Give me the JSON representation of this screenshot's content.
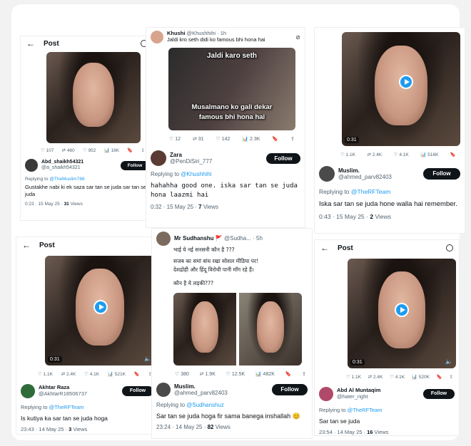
{
  "p1": {
    "header": {
      "back": "←",
      "title": "Post"
    },
    "stats": [
      "♡ 107",
      "⇄ 460",
      "♡ 952",
      "📊 16K",
      "🔖",
      "⇪"
    ],
    "user": {
      "name": "Abd_shaikh54321",
      "handle": "@a_shaikh54321"
    },
    "follow": "Follow",
    "reply_prefix": "Replying to ",
    "reply_to": "@TheMuslim786",
    "text": "Gustakhe nabi ki ek saza sar tan se juda sar tan se juda",
    "time": "0:23 · 15 May 25 · ",
    "views": "31",
    "views_label": " Views"
  },
  "p2": {
    "top": {
      "name": "Khushi",
      "handle": "@Khushhihi · 1h",
      "text": "Jaldi kro seth didi ko famous bhi hona hai"
    },
    "meme_top": "Jaldi karo seth",
    "meme_bottom1": "Musalmano ko gali dekar",
    "meme_bottom2": "famous bhi hona hai",
    "stats": [
      "♡ 12",
      "⇄ 31",
      "♡ 142",
      "📊 2.3K",
      "🔖",
      "⇪"
    ],
    "user": {
      "name": "Zara",
      "handle": "@PenDiSiri_777"
    },
    "follow": "Follow",
    "reply_prefix": "Replying to ",
    "reply_to": "@Khushhihi",
    "text": "hahahha good one. iska sar tan se juda hona laazmi hai",
    "time": "0:32 · 15 May 25 · ",
    "views": "7",
    "views_label": " Views"
  },
  "p3": {
    "dur": "0:31",
    "stats": [
      "♡ 1.1K",
      "⇄ 2.4K",
      "♡ 4.1K",
      "📊 516K",
      "🔖"
    ],
    "user": {
      "name": "Muslim.",
      "handle": "@ahmed_parv82403"
    },
    "follow": "Follow",
    "reply_prefix": "Replying to ",
    "reply_to": "@TheRFTeam",
    "text": "Iska sar tan se juda hone walla hai remember.",
    "time": "0:43 · 15 May 25 · ",
    "views": "2",
    "views_label": " Views"
  },
  "p4": {
    "header": {
      "back": "←",
      "title": "Post"
    },
    "dur": "0:31",
    "stats": [
      "♡ 1.1K",
      "⇄ 2.4K",
      "♡ 4.1K",
      "📊 521K",
      "🔖",
      "⇪"
    ],
    "user": {
      "name": "Akhtar Raza",
      "handle": "@AkhtarR18506737"
    },
    "follow": "Follow",
    "reply_prefix": "Replying to ",
    "reply_to": "@TheRFTeam",
    "text": "Is kutiya ka sar tan se juda hoga",
    "time": "23:43 · 14 May 25 · ",
    "views": "3",
    "views_label": " Views"
  },
  "p5": {
    "top": {
      "name": "Mr Sudhanshu 🚩",
      "handle": "@Sudha... · 5h"
    },
    "line1": "भाई ये नई सनसनी कौन है ???",
    "line2": "सजब का समां बांध रखा सोशल मीडिया पर!",
    "line3": "देशद्रोही और हिंदू विरोधी पानी माँग रहे हैं।",
    "line4": "कौन है ये लड़की???",
    "stats": [
      "♡ 380",
      "⇄ 1.9K",
      "♡ 12.5K",
      "📊 482K",
      "🔖",
      "⇪"
    ],
    "user": {
      "name": "Muslim.",
      "handle": "@ahmed_parv82403"
    },
    "follow": "Follow",
    "reply_prefix": "Replying to ",
    "reply_to": "@Sudhanshuz",
    "text": "Sar tan se juda hoga fir sama banega inshallah 😊",
    "time": "23:24 · 14 May 25 · ",
    "views": "82",
    "views_label": " Views"
  },
  "p6": {
    "header": {
      "back": "←",
      "title": "Post"
    },
    "dur": "0:31",
    "stats": [
      "♡ 1.1K",
      "⇄ 2.4K",
      "♡ 4.1K",
      "📊 520K",
      "🔖",
      "⇪"
    ],
    "user": {
      "name": "Abd Al Muntaqim",
      "handle": "@hater_right"
    },
    "follow": "Follow",
    "reply_prefix": "Replying to ",
    "reply_to": "@TheRFTeam",
    "text": "Sar tan se juda",
    "time": "23:54 · 14 May 25 · ",
    "views": "16",
    "views_label": " Views"
  }
}
